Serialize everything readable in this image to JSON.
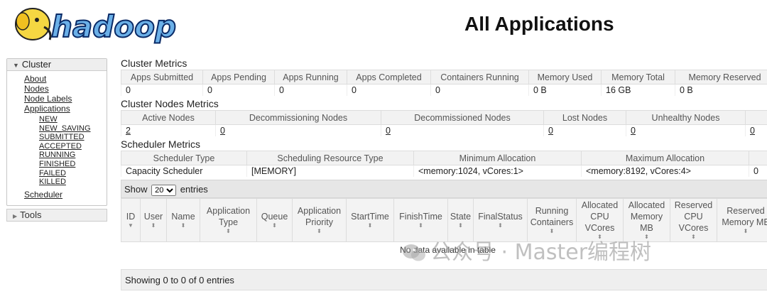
{
  "header": {
    "logo_text": "hadoop",
    "title": "All Applications"
  },
  "nav": {
    "cluster_label": "Cluster",
    "links": [
      "About",
      "Nodes",
      "Node Labels",
      "Applications"
    ],
    "app_states": [
      "NEW",
      "NEW_SAVING",
      "SUBMITTED",
      "ACCEPTED",
      "RUNNING",
      "FINISHED",
      "FAILED",
      "KILLED"
    ],
    "scheduler": "Scheduler",
    "tools": "Tools"
  },
  "cluster_metrics": {
    "title": "Cluster Metrics",
    "headers": [
      "Apps Submitted",
      "Apps Pending",
      "Apps Running",
      "Apps Completed",
      "Containers Running",
      "Memory Used",
      "Memory Total",
      "Memory Reserved"
    ],
    "values": [
      "0",
      "0",
      "0",
      "0",
      "0",
      "0 B",
      "16 GB",
      "0 B"
    ]
  },
  "nodes_metrics": {
    "title": "Cluster Nodes Metrics",
    "headers": [
      "Active Nodes",
      "Decommissioning Nodes",
      "Decommissioned Nodes",
      "Lost Nodes",
      "Unhealthy Nodes"
    ],
    "values": [
      "2",
      "0",
      "0",
      "0",
      "0",
      "0"
    ]
  },
  "scheduler_metrics": {
    "title": "Scheduler Metrics",
    "headers": [
      "Scheduler Type",
      "Scheduling Resource Type",
      "Minimum Allocation",
      "Maximum Allocation"
    ],
    "values": [
      "Capacity Scheduler",
      "[MEMORY]",
      "<memory:1024, vCores:1>",
      "<memory:8192, vCores:4>",
      "0"
    ]
  },
  "apps_table": {
    "show_label": "Show",
    "entries_value": "20",
    "entries_label": "entries",
    "columns": [
      "ID",
      "User",
      "Name",
      "Application Type",
      "Queue",
      "Application Priority",
      "StartTime",
      "FinishTime",
      "State",
      "FinalStatus",
      "Running Containers",
      "Allocated CPU VCores",
      "Allocated Memory MB",
      "Reserved CPU VCores",
      "Reserved Memory MB"
    ],
    "empty_message": "No data available in table",
    "footer": "Showing 0 to 0 of 0 entries"
  },
  "watermark": {
    "text": "公众号 · Master编程树"
  }
}
